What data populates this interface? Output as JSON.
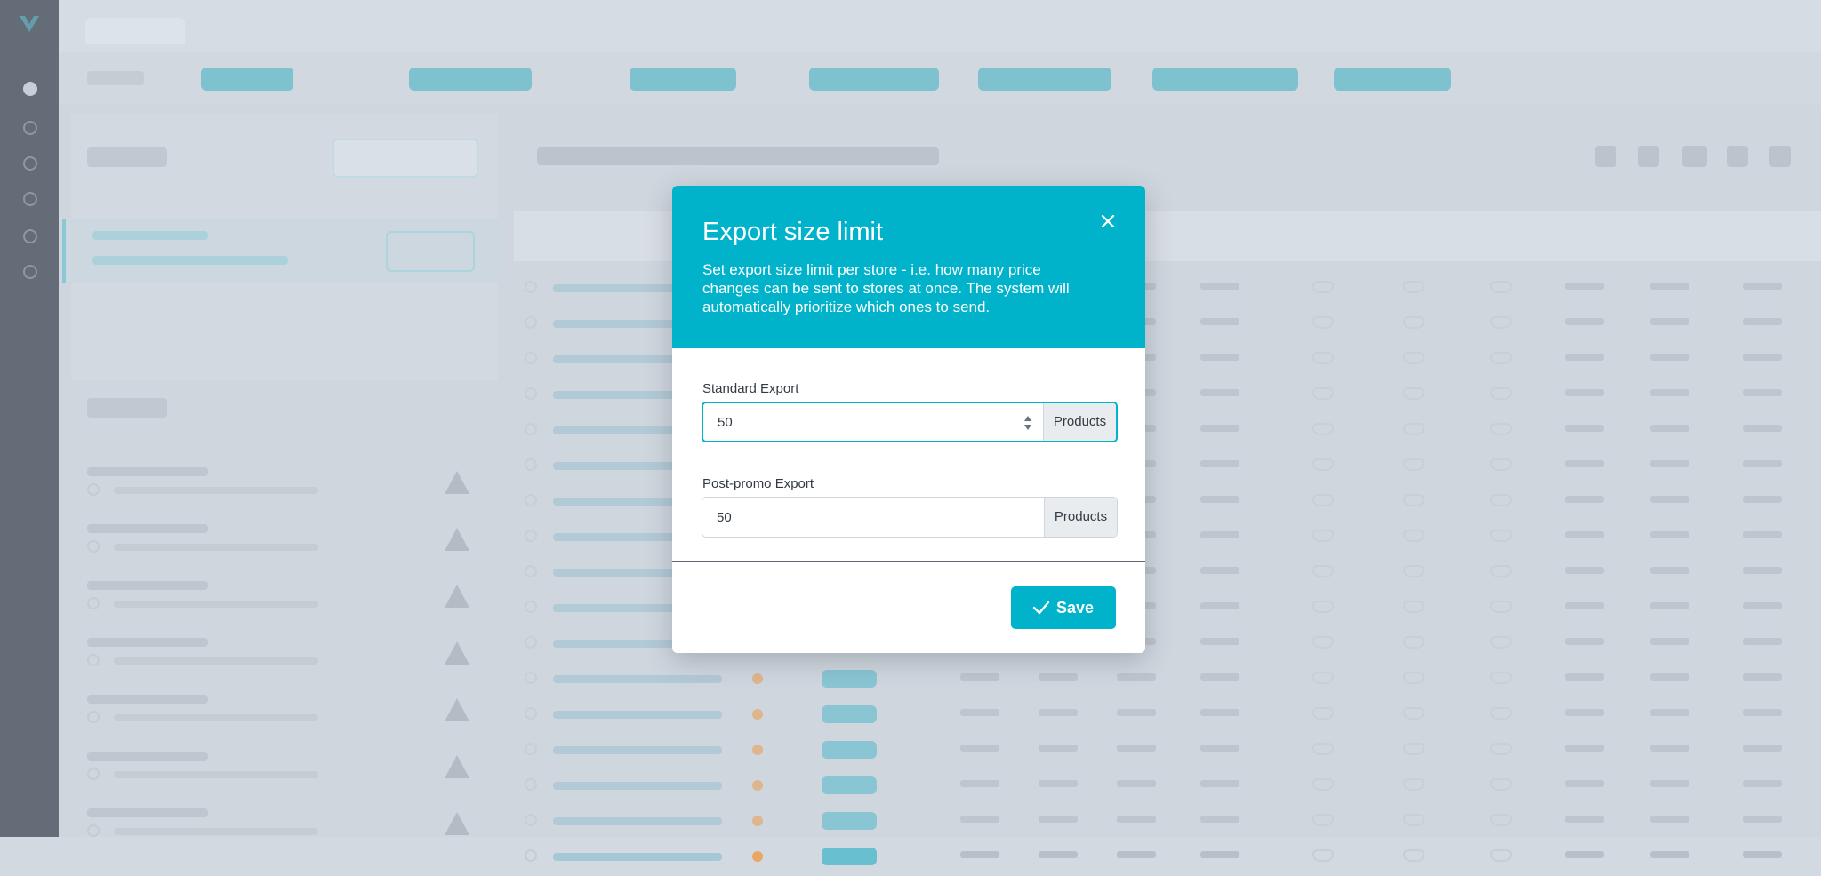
{
  "modal": {
    "title": "Export size limit",
    "description": "Set export size limit per store - i.e. how many price changes can be sent to stores at once. The system will automatically prioritize which ones to send.",
    "standard": {
      "label": "Standard Export",
      "value": "50",
      "unit": "Products"
    },
    "postpromo": {
      "label": "Post-promo Export",
      "value": "50",
      "unit": "Products"
    },
    "save_label": "Save"
  },
  "colors": {
    "accent": "#00b3cb",
    "sidebar": "#2f3743"
  },
  "icons": {
    "close": "close-icon",
    "save": "check-icon",
    "spinner": "spinner-arrows-icon"
  }
}
